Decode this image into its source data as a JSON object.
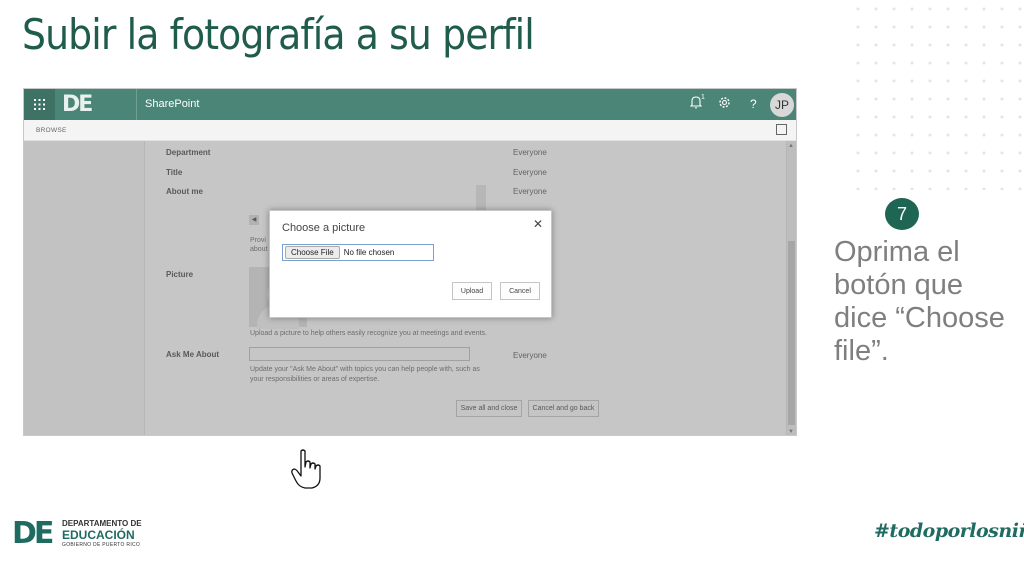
{
  "slide": {
    "title": "Subir la fotografía a su perfil",
    "step_number": "7",
    "instruction": "Oprima el botón que dice “Choose file”.",
    "hashtag": "#todoporlosniños",
    "footer_logo": {
      "mark": "DE",
      "line1": "DEPARTAMENTO DE",
      "line2": "EDUCACIÓN",
      "line3": "GOBIERNO DE PUERTO RICO"
    }
  },
  "sharepoint": {
    "logo_text": "DE",
    "site_name": "SharePoint",
    "notification_count": "1",
    "avatar_initials": "JP",
    "ribbon_tab": "BROWSE"
  },
  "profile_form": {
    "department_label": "Department",
    "title_label": "Title",
    "about_me_label": "About me",
    "picture_label": "Picture",
    "ask_me_about_label": "Ask Me About",
    "privacy_everyone": "Everyone",
    "about_hint_partial": "Provi",
    "about_hint_partial2": "about",
    "picture_hint": "Upload a picture to help others easily recognize you at meetings and events.",
    "ask_hint_line1": "Update your \"Ask Me About\" with topics you can help people with, such as",
    "ask_hint_line2": "your responsibilities or areas of expertise.",
    "save_all_close": "Save all and close",
    "cancel_go_back": "Cancel and go back"
  },
  "dialog": {
    "title": "Choose a picture",
    "choose_file_button": "Choose File",
    "file_status": "No file chosen",
    "upload_button": "Upload",
    "cancel_button": "Cancel"
  },
  "colors": {
    "sharepoint_bar": "#4a8577",
    "brand_green": "#1f5c4b",
    "step_badge": "#1e6553"
  }
}
